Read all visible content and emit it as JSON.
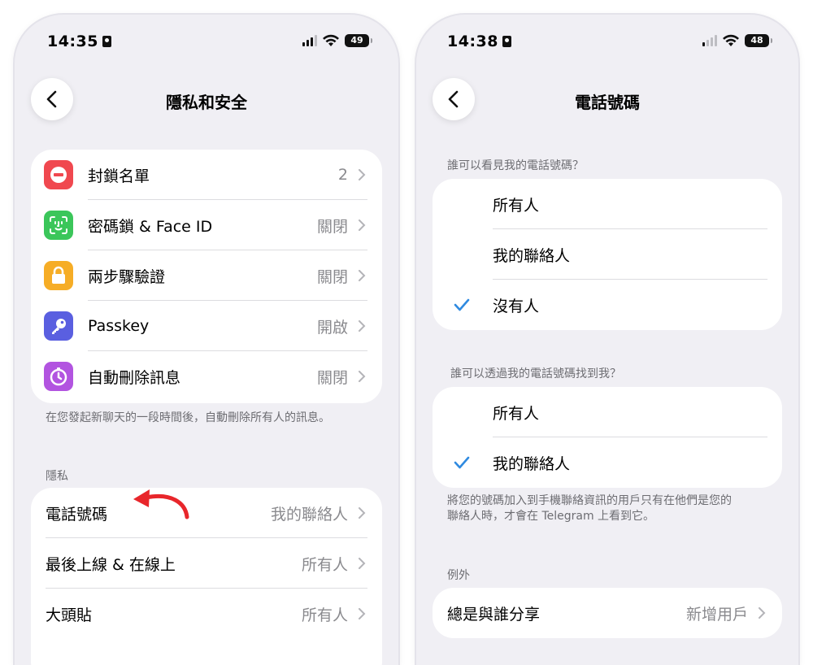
{
  "left": {
    "status": {
      "time": "14:35",
      "battery": "49"
    },
    "title": "隱私和安全",
    "security_items": [
      {
        "label": "封鎖名單",
        "value": "2",
        "icon": "blocked-icon",
        "color": "#f0484f"
      },
      {
        "label": "密碼鎖 & Face ID",
        "value": "關閉",
        "icon": "face-id-icon",
        "color": "#3bc65a"
      },
      {
        "label": "兩步驟驗證",
        "value": "關閉",
        "icon": "lock-icon",
        "color": "#f6ad26"
      },
      {
        "label": "Passkey",
        "value": "開啟",
        "icon": "key-icon",
        "color": "#5a5fe0"
      },
      {
        "label": "自動刪除訊息",
        "value": "關閉",
        "icon": "timer-icon",
        "color": "#b254e0"
      }
    ],
    "auto_delete_note": "在您發起新聊天的一段時間後，自動刪除所有人的訊息。",
    "privacy_header": "隱私",
    "privacy_items": [
      {
        "label": "電話號碼",
        "value": "我的聯絡人"
      },
      {
        "label": "最後上線 & 在線上",
        "value": "所有人"
      },
      {
        "label": "大頭貼",
        "value": "所有人"
      }
    ]
  },
  "right": {
    "status": {
      "time": "14:38",
      "battery": "48"
    },
    "title": "電話號碼",
    "see_header": "誰可以看見我的電話號碼？",
    "see_options": [
      {
        "label": "所有人",
        "checked": false
      },
      {
        "label": "我的聯絡人",
        "checked": false
      },
      {
        "label": "沒有人",
        "checked": true
      }
    ],
    "find_header": "誰可以透過我的電話號碼找到我？",
    "find_options": [
      {
        "label": "所有人",
        "checked": false
      },
      {
        "label": "我的聯絡人",
        "checked": true
      }
    ],
    "find_note_line1": "將您的號碼加入到手機聯絡資訊的用戶只有在他們是您的",
    "find_note_line2": "聯絡人時，才會在 Telegram 上看到它。",
    "exceptions_header": "例外",
    "exception_row": {
      "label": "總是與誰分享",
      "value": "新增用戶"
    }
  },
  "colors": {
    "accent": "#2f8ae0",
    "annotation_arrow": "#e8262b",
    "background": "#f0eff4"
  }
}
